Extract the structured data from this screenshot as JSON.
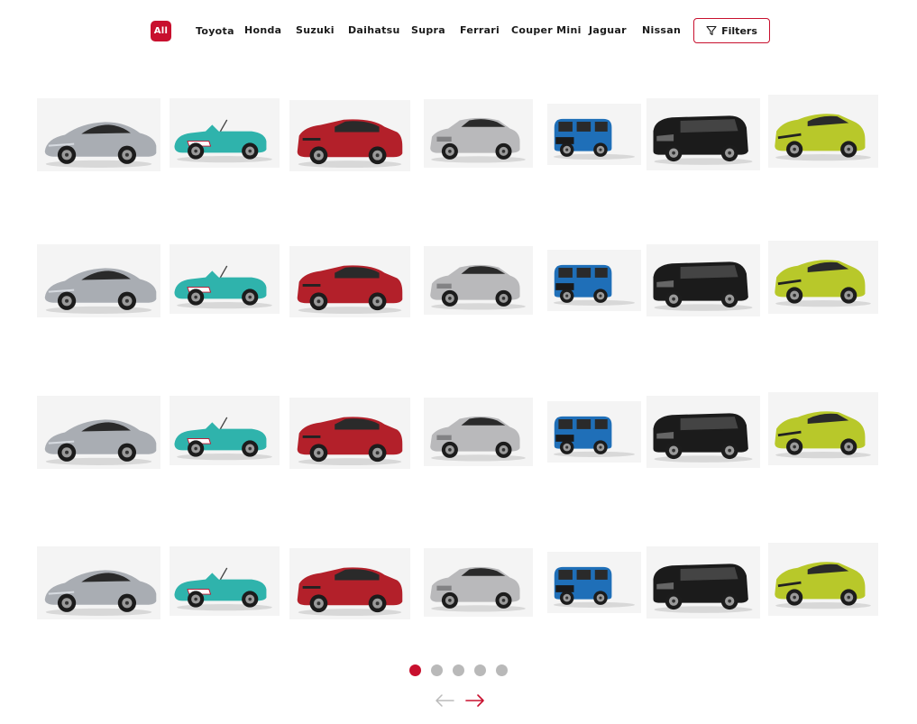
{
  "filters": {
    "tabs": [
      {
        "label": "All",
        "active": true
      },
      {
        "label": "Toyota"
      },
      {
        "label": "Honda"
      },
      {
        "label": "Suzuki"
      },
      {
        "label": "Daihatsu"
      },
      {
        "label": "Supra"
      },
      {
        "label": "Ferrari"
      },
      {
        "label": "Couper Mini"
      },
      {
        "label": "Jaguar"
      },
      {
        "label": "Nissan"
      }
    ],
    "filters_button_label": "Filters",
    "filters_icon": "filter-icon"
  },
  "cars": [
    {
      "name": "toyota-supra",
      "type": "coupe",
      "color": "#a9adb3"
    },
    {
      "name": "mini-convertible",
      "type": "convertible",
      "color": "#2fb3ac"
    },
    {
      "name": "toyota-corolla-cross",
      "type": "suv",
      "color": "#b3202a"
    },
    {
      "name": "toyota-vios",
      "type": "sedan",
      "color": "#b9b9bb"
    },
    {
      "name": "suzuki-jimny",
      "type": "boxy",
      "color": "#1f6fb8"
    },
    {
      "name": "toyota-voxy",
      "type": "van",
      "color": "#1b1b1b"
    },
    {
      "name": "toyota-yaris",
      "type": "hatch",
      "color": "#b8c82a"
    }
  ],
  "rows": 4,
  "pagination": {
    "pages": 5,
    "active_page": 1,
    "active_color": "#c8102e",
    "inactive_color": "#b9b9b9"
  },
  "nav": {
    "prev_icon": "arrow-left-icon",
    "next_icon": "arrow-right-icon"
  }
}
